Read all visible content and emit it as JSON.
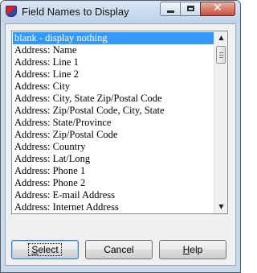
{
  "window": {
    "title": "Field Names to Display"
  },
  "listbox": {
    "items": [
      "blank - display nothing",
      "Address: Name",
      "Address: Line 1",
      "Address: Line 2",
      "Address: City",
      "Address: City, State Zip/Postal Code",
      "Address: Zip/Postal Code, City, State",
      "Address: State/Province",
      "Address: Zip/Postal Code",
      "Address: Country",
      "Address: Lat/Long",
      "Address: Phone 1",
      "Address: Phone 2",
      "Address: E-mail Address",
      "Address: Internet Address"
    ],
    "selected_index": 0
  },
  "buttons": {
    "select": {
      "mnemonic": "S",
      "rest": "elect"
    },
    "cancel": "Cancel",
    "help": {
      "mnemonic": "H",
      "rest": "elp"
    }
  },
  "colors": {
    "selection": "#3399ff",
    "titlebar": "#bed3ea",
    "close_button": "#c7503a",
    "dialog_face": "#f0f0f0"
  },
  "icons": {
    "app": "app-shield-icon",
    "minimize": "minimize-icon",
    "maximize": "maximize-icon",
    "close": "close-icon",
    "scroll_up": "scroll-up-arrow-icon",
    "scroll_down": "scroll-down-arrow-icon"
  }
}
